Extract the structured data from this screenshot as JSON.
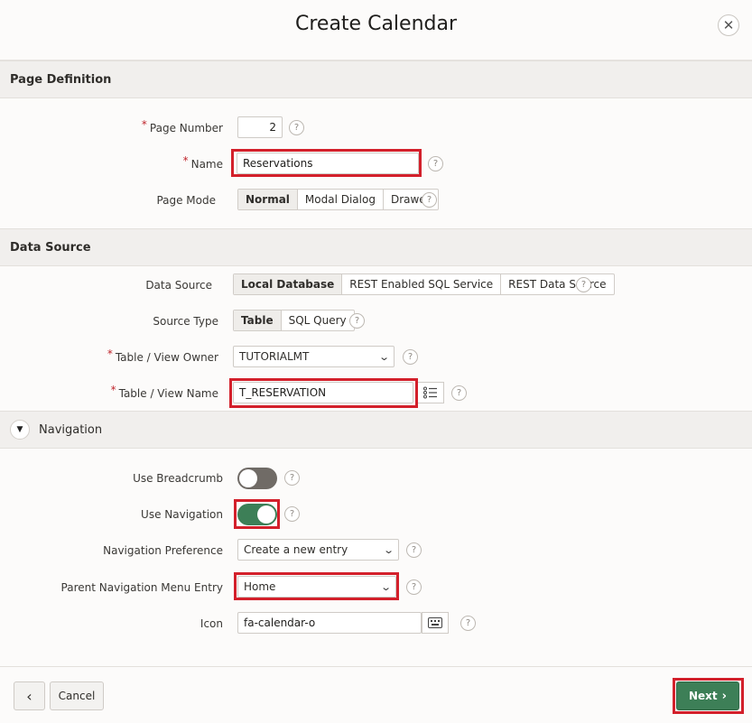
{
  "dialog": {
    "title": "Create Calendar",
    "close_glyph": "✕"
  },
  "page_definition": {
    "title": "Page Definition",
    "page_number": {
      "label": "Page Number",
      "value": "2"
    },
    "name": {
      "label": "Name",
      "value": "Reservations"
    },
    "page_mode": {
      "label": "Page Mode",
      "options": [
        "Normal",
        "Modal Dialog",
        "Drawer"
      ],
      "selected": "Normal"
    }
  },
  "data_source": {
    "title": "Data Source",
    "source": {
      "label": "Data Source",
      "options": [
        "Local Database",
        "REST Enabled SQL Service",
        "REST Data Source"
      ],
      "selected": "Local Database"
    },
    "source_type": {
      "label": "Source Type",
      "options": [
        "Table",
        "SQL Query"
      ],
      "selected": "Table"
    },
    "owner": {
      "label": "Table / View Owner",
      "value": "TUTORIALMT"
    },
    "table_name": {
      "label": "Table / View Name",
      "value": "T_RESERVATION"
    }
  },
  "navigation": {
    "title": "Navigation",
    "use_breadcrumb": {
      "label": "Use Breadcrumb",
      "on": false
    },
    "use_navigation": {
      "label": "Use Navigation",
      "on": true
    },
    "preference": {
      "label": "Navigation Preference",
      "value": "Create a new entry"
    },
    "parent_entry": {
      "label": "Parent Navigation Menu Entry",
      "value": "Home"
    },
    "icon": {
      "label": "Icon",
      "value": "fa-calendar-o"
    }
  },
  "footer": {
    "back_glyph": "‹",
    "cancel_label": "Cancel",
    "next_label": "Next"
  },
  "colors": {
    "accent": "#3d7f57",
    "highlight": "#d3202b",
    "toggle_off": "#706b66"
  },
  "help_glyph": "?"
}
